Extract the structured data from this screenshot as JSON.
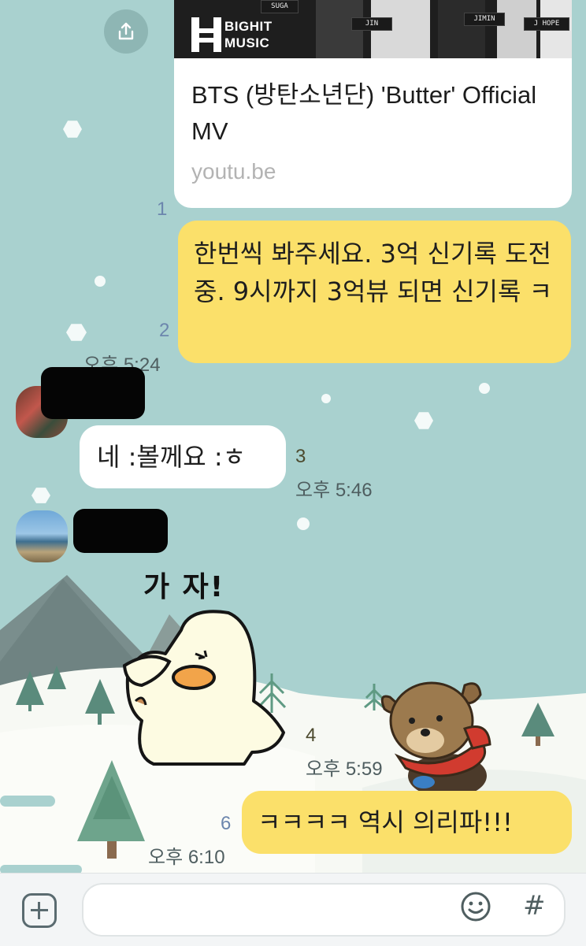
{
  "link_preview": {
    "thumb_logo_line1": "BIGHIT",
    "thumb_logo_line2": "MUSIC",
    "thumb_signs": [
      "SUGA",
      "JIN",
      "JIMIN",
      "J HOPE"
    ],
    "title": "BTS (방탄소년단) 'Butter' Official MV",
    "domain": "youtu.be",
    "unread_count": "1"
  },
  "messages": [
    {
      "id": "msg1",
      "text": "한번씩 봐주세요. 3억 신기록 도전중. 9시까지 3억뷰 되면 신기록 ㅋ",
      "unread_count": "2",
      "time": "오후 5:24"
    },
    {
      "id": "msg2",
      "text": "네 :볼께요 :ㅎ",
      "unread_count": "3",
      "time": "오후 5:46"
    },
    {
      "id": "msg3",
      "sticker_caption": "가 자!",
      "unread_count": "4",
      "time": "오후 5:59"
    },
    {
      "id": "msg4",
      "text": "ㅋㅋㅋㅋ 역시 의리파!!!",
      "unread_count": "6",
      "time": "오후 6:10"
    }
  ],
  "input_bar": {
    "placeholder": "",
    "hash_symbol": "#"
  },
  "icons": {
    "share": "share-icon",
    "add": "plus-icon",
    "emoji": "emoji-icon",
    "hash": "hash-icon"
  },
  "colors": {
    "background": "#a9d1cf",
    "my_bubble": "#fbe06a",
    "their_bubble": "#ffffff",
    "unread": "#6c86ad"
  }
}
